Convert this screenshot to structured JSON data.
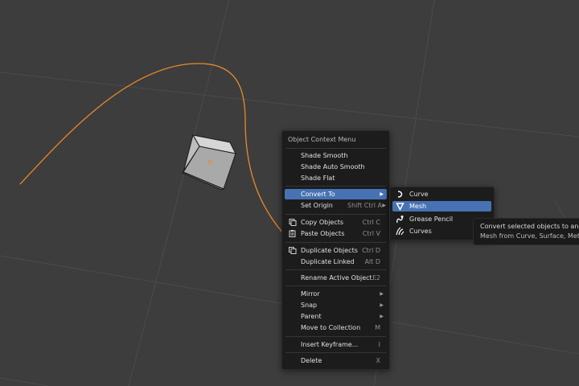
{
  "context_menu": {
    "title": "Object Context Menu",
    "items": [
      {
        "label": "Shade Smooth"
      },
      {
        "label": "Shade Auto Smooth"
      },
      {
        "label": "Shade Flat"
      },
      {
        "label": "Convert To"
      },
      {
        "label": "Set Origin",
        "shortcut": "Shift Ctrl A"
      },
      {
        "label": "Copy Objects",
        "shortcut": "Ctrl C"
      },
      {
        "label": "Paste Objects",
        "shortcut": "Ctrl V"
      },
      {
        "label": "Duplicate Objects",
        "shortcut": "Ctrl D"
      },
      {
        "label": "Duplicate Linked",
        "shortcut": "Alt D"
      },
      {
        "label": "Rename Active Object...",
        "shortcut": "F2"
      },
      {
        "label": "Mirror"
      },
      {
        "label": "Snap"
      },
      {
        "label": "Parent"
      },
      {
        "label": "Move to Collection",
        "shortcut": "M"
      },
      {
        "label": "Insert Keyframe...",
        "shortcut": "I"
      },
      {
        "label": "Delete",
        "shortcut": "X"
      }
    ]
  },
  "convert_submenu": {
    "items": [
      {
        "label": "Curve",
        "icon": "curve-icon"
      },
      {
        "label": "Mesh",
        "icon": "mesh-icon"
      },
      {
        "label": "Grease Pencil",
        "icon": "grease-pencil-icon"
      },
      {
        "label": "Curves",
        "icon": "curves-icon"
      }
    ]
  },
  "tooltip": {
    "line1": "Convert selected objects to another",
    "line2": "Mesh from Curve, Surface, Metaball"
  },
  "colors": {
    "background": "#3d3d3d",
    "grid_line": "#4d4d4d",
    "curve": "#e8892a",
    "highlight": "#4772b3",
    "menu_bg": "#1c1c1c"
  }
}
